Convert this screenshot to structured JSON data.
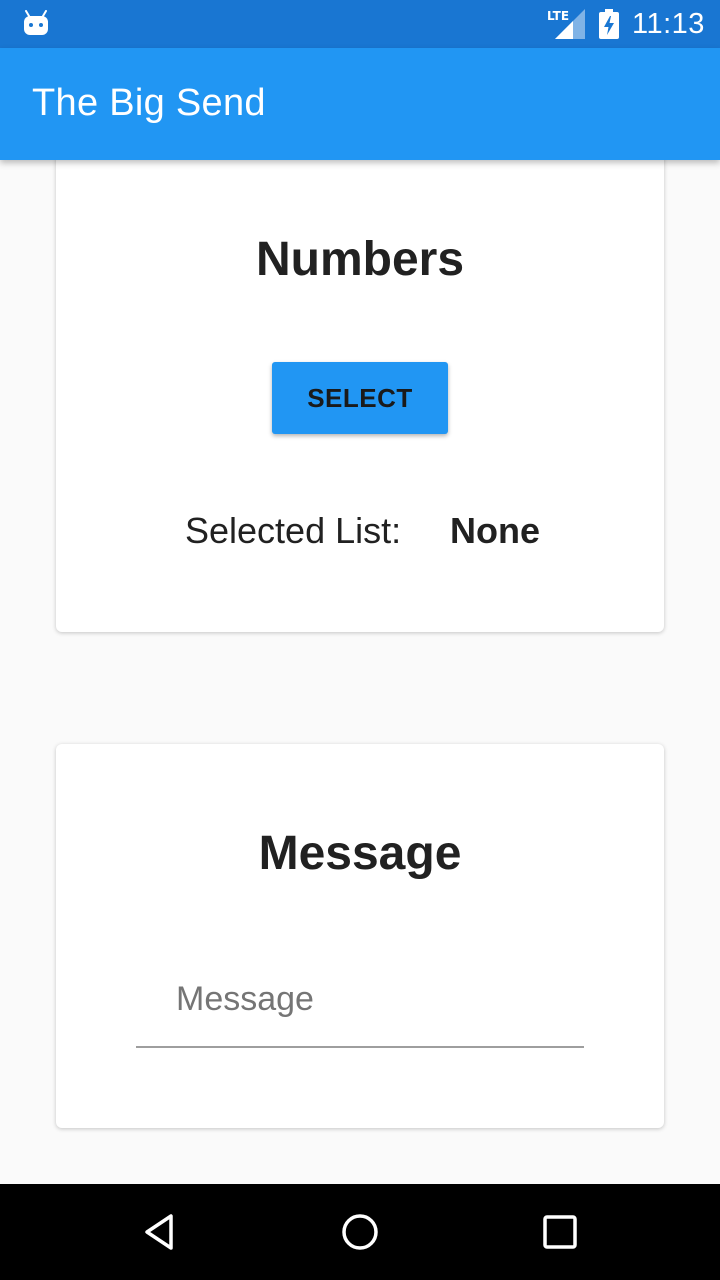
{
  "status_bar": {
    "time": "11:13",
    "network_label": "LTE",
    "icons": [
      "android-icon",
      "lte-signal-icon",
      "battery-charging-icon"
    ]
  },
  "app_bar": {
    "title": "The Big Send",
    "color": "#2196f3",
    "status_color": "#1976d2"
  },
  "numbers_card": {
    "title": "Numbers",
    "select_label": "SELECT",
    "selected_label": "Selected List:",
    "selected_value": "None"
  },
  "message_card": {
    "title": "Message",
    "input_placeholder": "Message",
    "input_value": ""
  },
  "nav_bar": {
    "icons": [
      "back-icon",
      "home-icon",
      "recents-icon"
    ]
  }
}
